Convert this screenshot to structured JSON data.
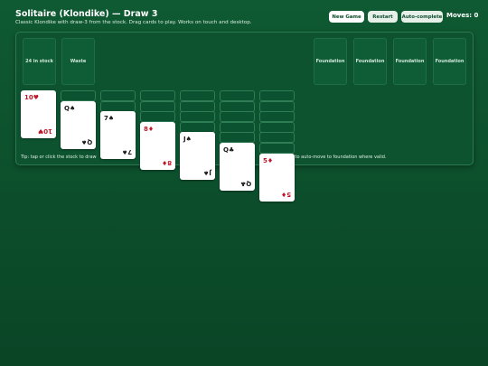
{
  "header": {
    "title": "Solitaire (Klondike) — Draw 3",
    "subtitle": "Classic Klondike with draw-3 from the stock. Drag cards to play. Works on touch and desktop."
  },
  "toolbar": {
    "new_game": "New Game",
    "restart": "Restart",
    "auto_complete": "Auto-complete",
    "moves_label": "Moves: 0"
  },
  "top_row": {
    "stock": "24 in stock",
    "waste": "Waste",
    "foundations": [
      "Foundation",
      "Foundation",
      "Foundation",
      "Foundation"
    ]
  },
  "tableau": [
    {
      "facedown": 0,
      "rank": "10",
      "suit": "♥",
      "color": "red"
    },
    {
      "facedown": 1,
      "rank": "Q",
      "suit": "♠",
      "color": "black"
    },
    {
      "facedown": 2,
      "rank": "7",
      "suit": "♠",
      "color": "black"
    },
    {
      "facedown": 3,
      "rank": "8",
      "suit": "♦",
      "color": "red"
    },
    {
      "facedown": 4,
      "rank": "J",
      "suit": "♠",
      "color": "black"
    },
    {
      "facedown": 5,
      "rank": "Q",
      "suit": "♣",
      "color": "black"
    },
    {
      "facedown": 6,
      "rank": "5",
      "suit": "♦",
      "color": "red"
    }
  ],
  "tip": {
    "left": "Tip: tap or click the stock to draw",
    "right": "card to auto-move to foundation where valid."
  },
  "colors": {
    "background": "#0c4d2b",
    "red_suit": "#c0182a",
    "black_suit": "#1a1a1a"
  }
}
